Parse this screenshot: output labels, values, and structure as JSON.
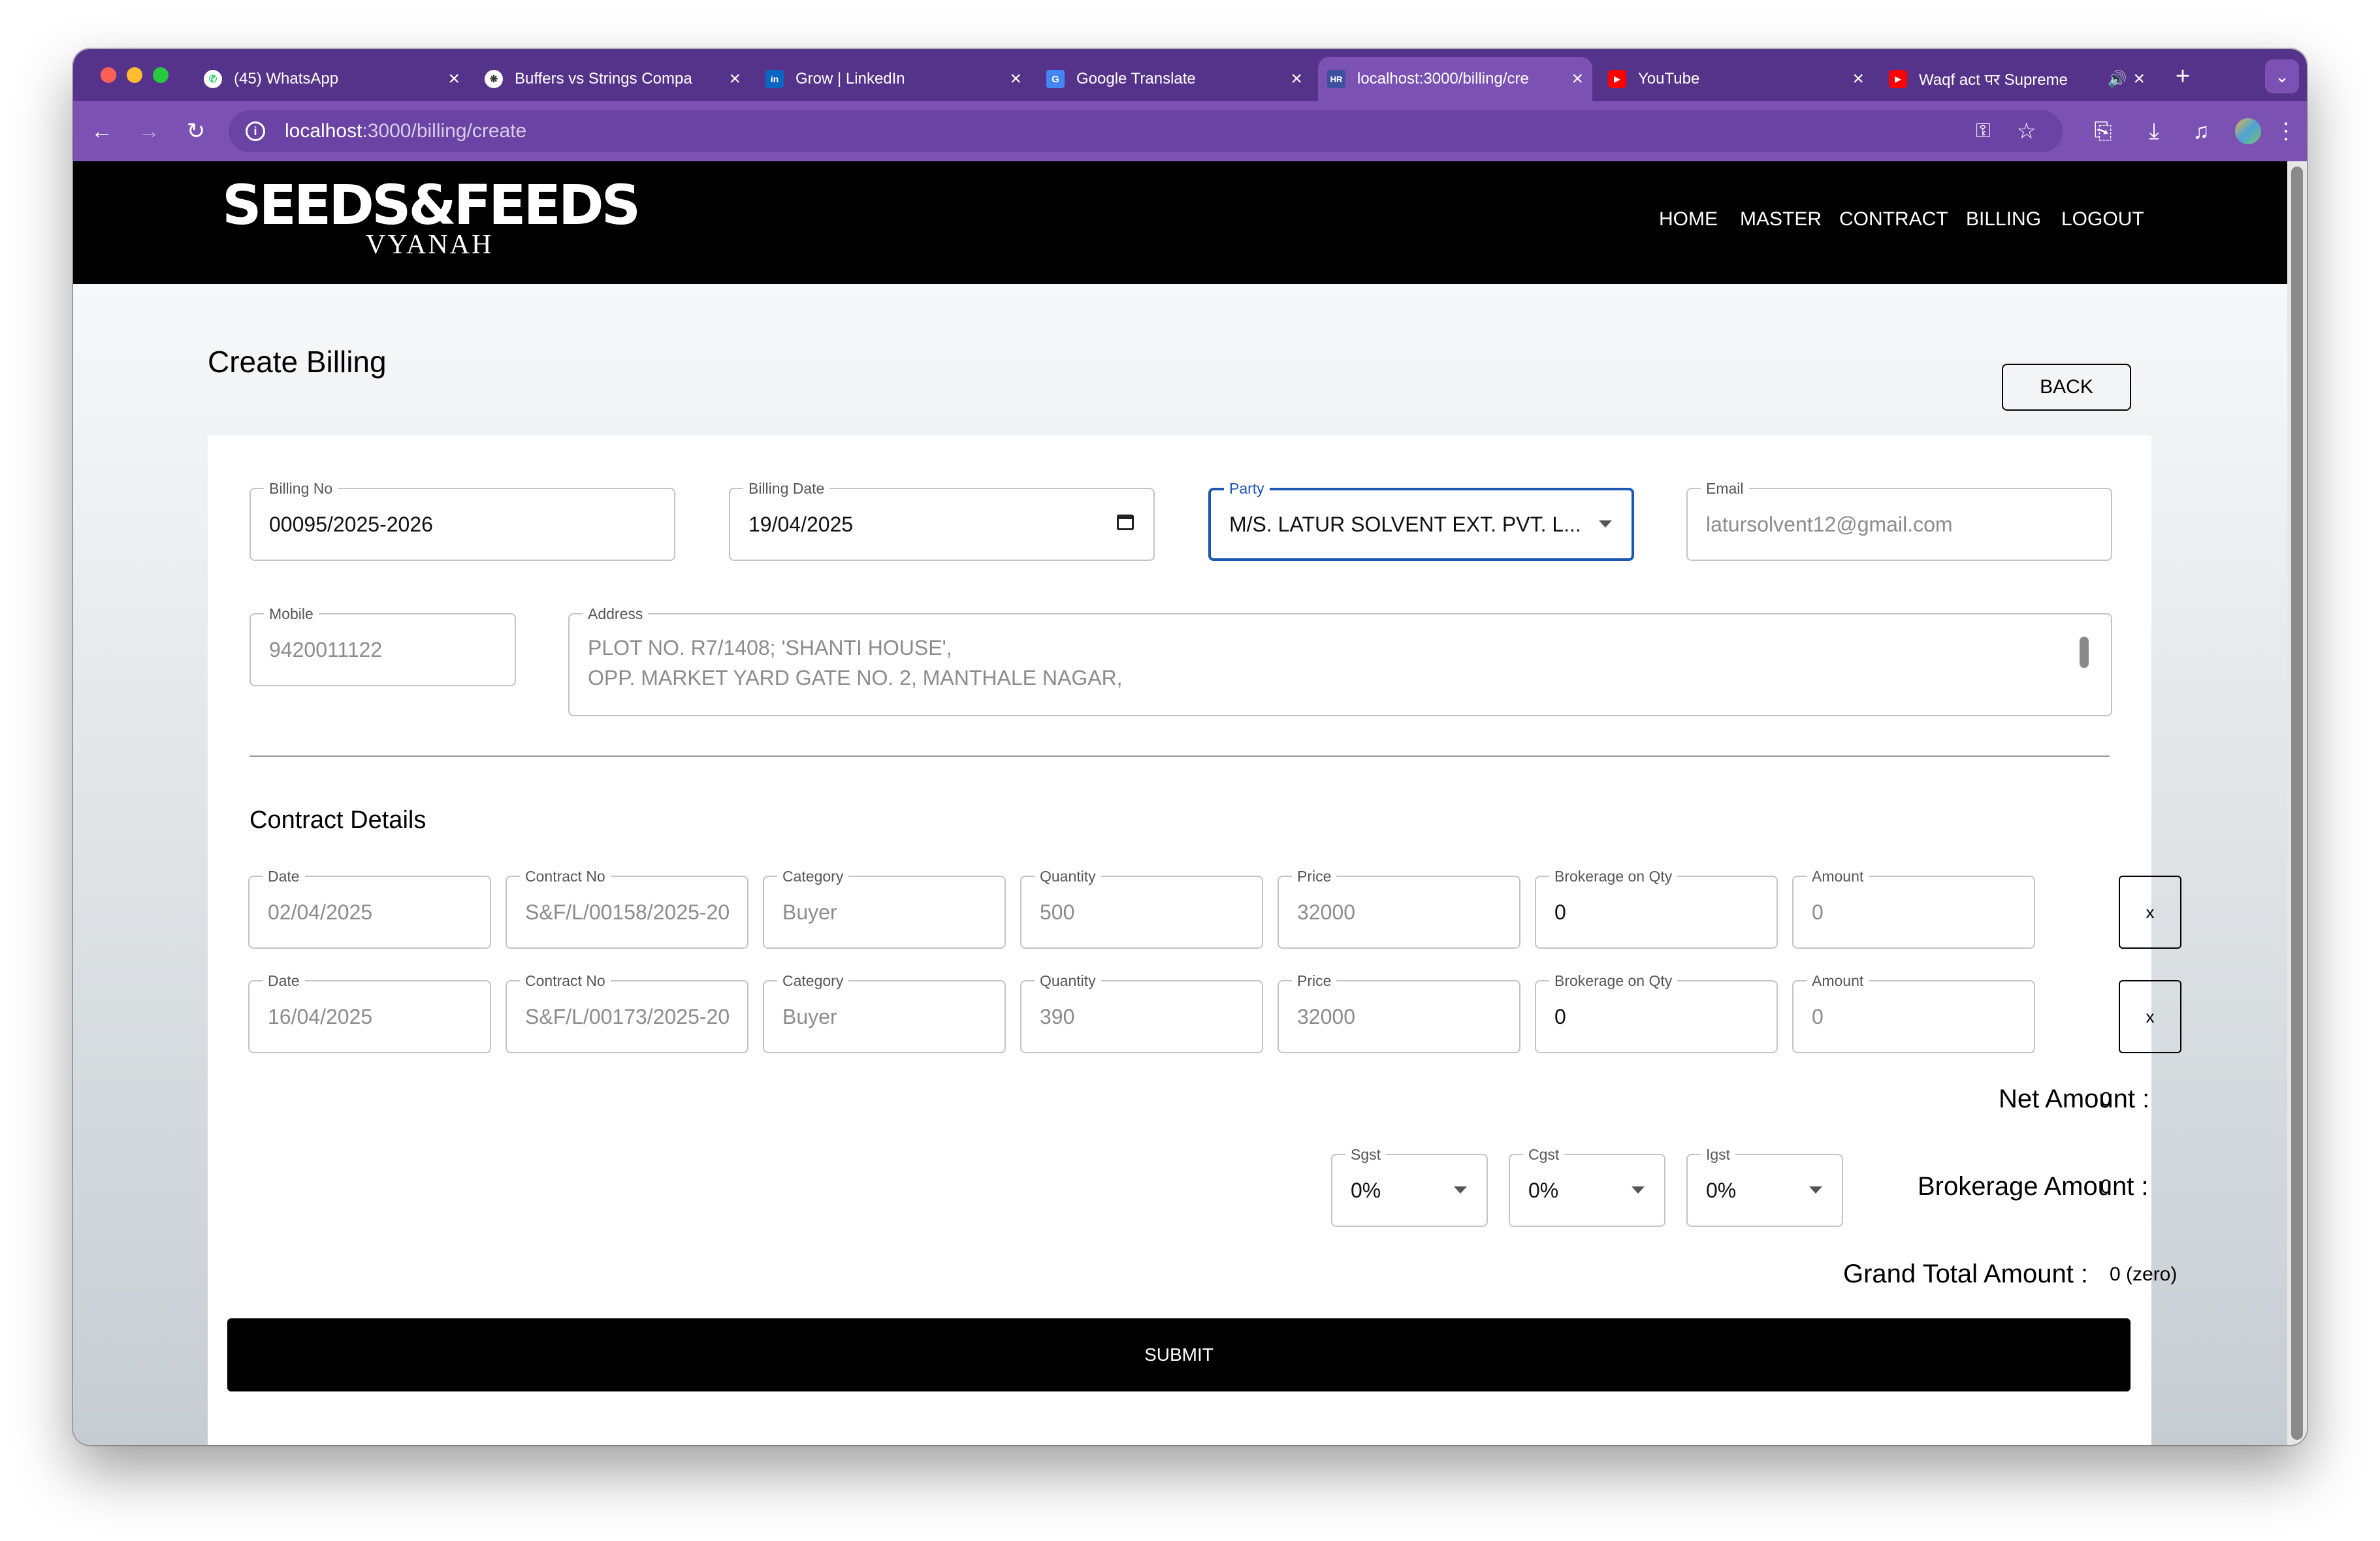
{
  "browser": {
    "tabs": [
      {
        "title": "(45) WhatsApp",
        "icon": "whatsapp-icon",
        "color": "#25d366",
        "active": false
      },
      {
        "title": "Buffers vs Strings Compa",
        "icon": "openai-icon",
        "color": "#4a4a4a",
        "active": false
      },
      {
        "title": "Grow | LinkedIn",
        "icon": "linkedin-icon",
        "color": "#0a66c2",
        "active": false
      },
      {
        "title": "Google Translate",
        "icon": "google-translate-icon",
        "color": "#4285f4",
        "active": false
      },
      {
        "title": "localhost:3000/billing/cre",
        "icon": "hr-icon",
        "color": "#3c4fa0",
        "active": true
      },
      {
        "title": "YouTube",
        "icon": "youtube-icon",
        "color": "#ff0000",
        "active": false
      },
      {
        "title": "Waqf act पर Supreme",
        "icon": "youtube-icon",
        "color": "#ff0000",
        "active": false
      }
    ],
    "url_host": "localhost",
    "url_rest": ":3000/billing/create"
  },
  "app": {
    "logo_main": "SEEDS&FEEDS",
    "logo_sub": "VYANAH",
    "nav": [
      "HOME",
      "MASTER",
      "CONTRACT",
      "BILLING",
      "LOGOUT"
    ]
  },
  "page": {
    "title": "Create Billing",
    "back_label": "BACK"
  },
  "form": {
    "billing_no": {
      "label": "Billing No",
      "value": "00095/2025-2026"
    },
    "billing_date": {
      "label": "Billing Date",
      "value": "19/04/2025"
    },
    "party": {
      "label": "Party",
      "value": "M/S. LATUR SOLVENT EXT. PVT. L..."
    },
    "email": {
      "label": "Email",
      "value": "latursolvent12@gmail.com"
    },
    "mobile": {
      "label": "Mobile",
      "value": "9420011122"
    },
    "address": {
      "label": "Address",
      "line1": "PLOT NO. R7/1408; 'SHANTI HOUSE',",
      "line2": "OPP. MARKET YARD GATE NO. 2, MANTHALE NAGAR,"
    }
  },
  "contract_details": {
    "heading": "Contract Details",
    "labels": {
      "date": "Date",
      "contract_no": "Contract No",
      "category": "Category",
      "quantity": "Quantity",
      "price": "Price",
      "brokerage": "Brokerage on Qty",
      "amount": "Amount"
    },
    "remove_label": "x",
    "rows": [
      {
        "date": "02/04/2025",
        "contract_no": "S&F/L/00158/2025-20",
        "category": "Buyer",
        "quantity": "500",
        "price": "32000",
        "brokerage": "0",
        "amount": "0"
      },
      {
        "date": "16/04/2025",
        "contract_no": "S&F/L/00173/2025-20",
        "category": "Buyer",
        "quantity": "390",
        "price": "32000",
        "brokerage": "0",
        "amount": "0"
      }
    ]
  },
  "totals": {
    "net_label": "Net Amount :",
    "net_value": "0",
    "sgst": {
      "label": "Sgst",
      "value": "0%"
    },
    "cgst": {
      "label": "Cgst",
      "value": "0%"
    },
    "igst": {
      "label": "Igst",
      "value": "0%"
    },
    "brokerage_label": "Brokerage Amount :",
    "brokerage_value": "0",
    "grand_label": "Grand Total Amount :",
    "grand_value": "0 (zero)"
  },
  "submit_label": "SUBMIT"
}
